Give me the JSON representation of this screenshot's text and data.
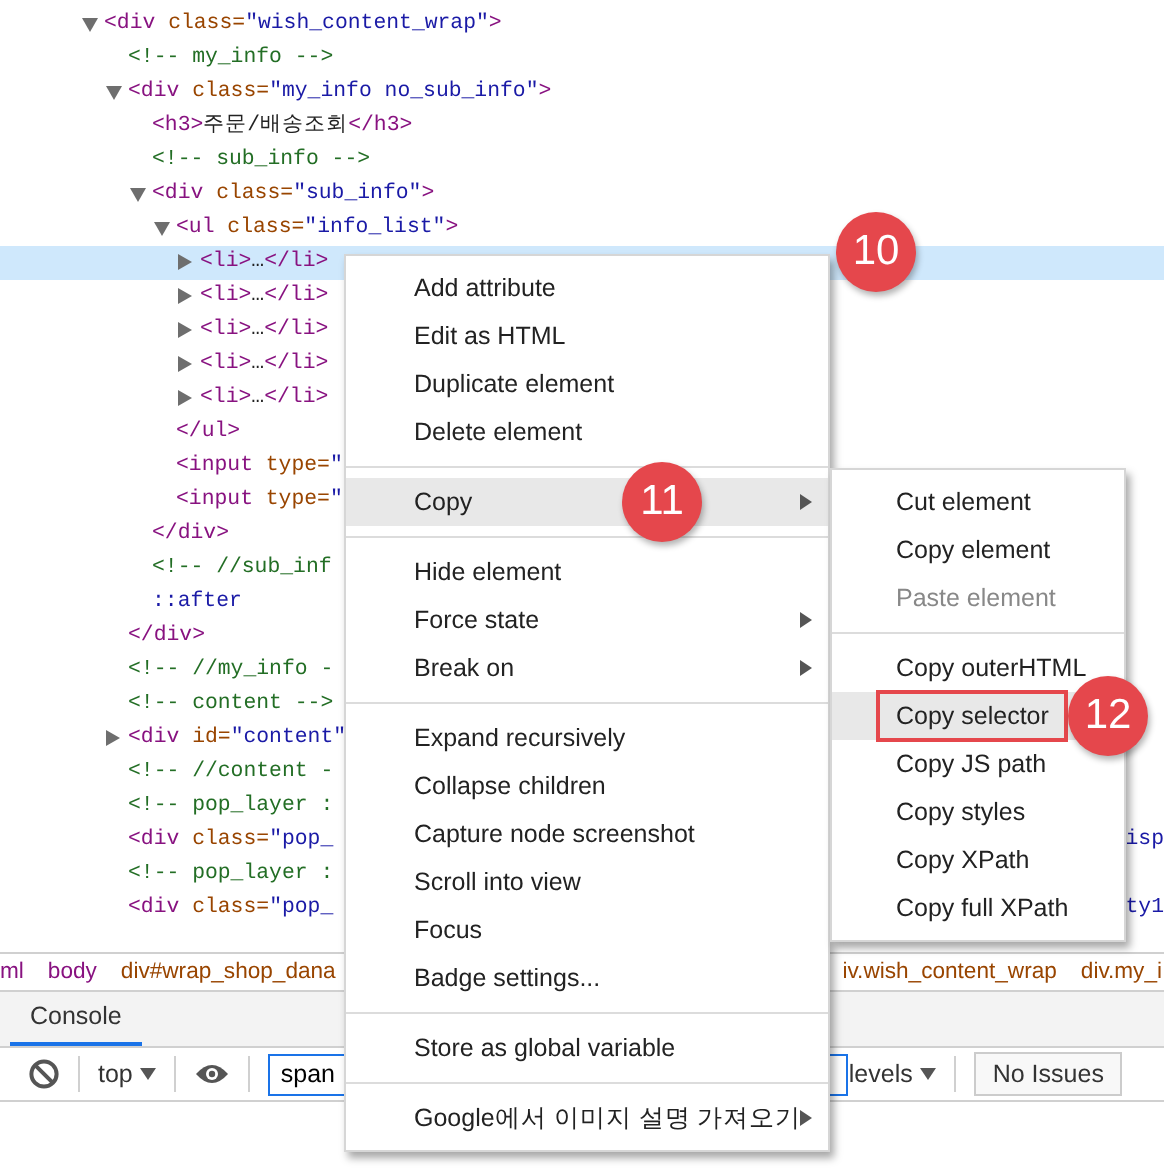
{
  "elements_tree": [
    {
      "expanded": true,
      "tokens": [
        {
          "kind": "tag",
          "text": "<div"
        },
        {
          "kind": "attr",
          "text": " class="
        },
        {
          "kind": "value",
          "text": "\"wish_content_wrap\""
        },
        {
          "kind": "tag",
          "text": ">"
        }
      ],
      "children": [
        {
          "tokens": [
            {
              "kind": "comment",
              "text": "<!-- my_info -->"
            }
          ]
        },
        {
          "expanded": true,
          "tokens": [
            {
              "kind": "tag",
              "text": "<div"
            },
            {
              "kind": "attr",
              "text": " class="
            },
            {
              "kind": "value",
              "text": "\"my_info no_sub_info\""
            },
            {
              "kind": "tag",
              "text": ">"
            }
          ],
          "children": [
            {
              "tokens": [
                {
                  "kind": "tag",
                  "text": "<h3>"
                },
                {
                  "kind": "text",
                  "text": "주문/배송조회"
                },
                {
                  "kind": "tag",
                  "text": "</h3>"
                }
              ]
            },
            {
              "tokens": [
                {
                  "kind": "comment",
                  "text": "<!-- sub_info -->"
                }
              ]
            },
            {
              "expanded": true,
              "tokens": [
                {
                  "kind": "tag",
                  "text": "<div"
                },
                {
                  "kind": "attr",
                  "text": " class="
                },
                {
                  "kind": "value",
                  "text": "\"sub_info\""
                },
                {
                  "kind": "tag",
                  "text": ">"
                }
              ],
              "children": [
                {
                  "expanded": true,
                  "tokens": [
                    {
                      "kind": "tag",
                      "text": "<ul"
                    },
                    {
                      "kind": "attr",
                      "text": " class="
                    },
                    {
                      "kind": "value",
                      "text": "\"info_list\""
                    },
                    {
                      "kind": "tag",
                      "text": ">"
                    }
                  ],
                  "children": [
                    {
                      "expanded": false,
                      "selected": true,
                      "tokens": [
                        {
                          "kind": "tag",
                          "text": "<li>"
                        },
                        {
                          "kind": "text",
                          "text": "…"
                        },
                        {
                          "kind": "tag",
                          "text": "</li>"
                        }
                      ]
                    },
                    {
                      "expanded": false,
                      "selected": false,
                      "tokens": [
                        {
                          "kind": "tag",
                          "text": "<li>"
                        },
                        {
                          "kind": "text",
                          "text": "…"
                        },
                        {
                          "kind": "tag",
                          "text": "</li>"
                        }
                      ]
                    },
                    {
                      "expanded": false,
                      "selected": false,
                      "tokens": [
                        {
                          "kind": "tag",
                          "text": "<li>"
                        },
                        {
                          "kind": "text",
                          "text": "…"
                        },
                        {
                          "kind": "tag",
                          "text": "</li>"
                        }
                      ]
                    },
                    {
                      "expanded": false,
                      "selected": false,
                      "tokens": [
                        {
                          "kind": "tag",
                          "text": "<li>"
                        },
                        {
                          "kind": "text",
                          "text": "…"
                        },
                        {
                          "kind": "tag",
                          "text": "</li>"
                        }
                      ]
                    },
                    {
                      "expanded": false,
                      "selected": false,
                      "tokens": [
                        {
                          "kind": "tag",
                          "text": "<li>"
                        },
                        {
                          "kind": "text",
                          "text": "…"
                        },
                        {
                          "kind": "tag",
                          "text": "</li>"
                        }
                      ]
                    }
                  ],
                  "closing": [
                    {
                      "kind": "tag",
                      "text": "</ul>"
                    }
                  ]
                },
                {
                  "tokens": [
                    {
                      "kind": "tag",
                      "text": "<input"
                    },
                    {
                      "kind": "attr",
                      "text": " type="
                    },
                    {
                      "kind": "value",
                      "text": "\""
                    }
                  ]
                },
                {
                  "tokens": [
                    {
                      "kind": "tag",
                      "text": "<input"
                    },
                    {
                      "kind": "attr",
                      "text": " type="
                    },
                    {
                      "kind": "value",
                      "text": "\""
                    }
                  ]
                }
              ],
              "closing": [
                {
                  "kind": "tag",
                  "text": "</div>"
                }
              ]
            },
            {
              "tokens": [
                {
                  "kind": "comment",
                  "text": "<!-- //sub_inf"
                }
              ]
            },
            {
              "tokens": [
                {
                  "kind": "pseudo",
                  "text": "::after"
                }
              ]
            }
          ],
          "closing": [
            {
              "kind": "tag",
              "text": "</div>"
            }
          ]
        },
        {
          "tokens": [
            {
              "kind": "comment",
              "text": "<!-- //my_info -"
            }
          ]
        },
        {
          "tokens": [
            {
              "kind": "comment",
              "text": "<!-- content -->"
            }
          ]
        },
        {
          "expanded": false,
          "tokens": [
            {
              "kind": "tag",
              "text": "<div"
            },
            {
              "kind": "attr",
              "text": " id="
            },
            {
              "kind": "value",
              "text": "\"content\""
            }
          ]
        },
        {
          "tokens": [
            {
              "kind": "comment",
              "text": "<!-- //content -"
            }
          ]
        },
        {
          "tokens": [
            {
              "kind": "comment",
              "text": "<!-- pop_layer :"
            }
          ]
        },
        {
          "tokens": [
            {
              "kind": "tag",
              "text": "<div"
            },
            {
              "kind": "attr",
              "text": " class="
            },
            {
              "kind": "value",
              "text": "\"pop_"
            }
          ],
          "tail": "isp"
        },
        {
          "tokens": [
            {
              "kind": "comment",
              "text": "<!-- pop_layer :"
            }
          ]
        },
        {
          "tokens": [
            {
              "kind": "tag",
              "text": "<div"
            },
            {
              "kind": "attr",
              "text": " class="
            },
            {
              "kind": "value",
              "text": "\"pop_"
            }
          ],
          "tail": "ty1"
        }
      ]
    }
  ],
  "breadcrumbs": [
    "ml",
    "body",
    "div#wrap_shop_dana",
    "iv.wish_content_wrap",
    "div.my_i"
  ],
  "drawer_tabs": [
    {
      "label": "Console",
      "selected": true
    }
  ],
  "console_toolbar": {
    "context": "top",
    "filter_value": "span",
    "levels": "levels",
    "issues": "No Issues"
  },
  "context_menu": {
    "callout": "10",
    "items": [
      {
        "kind": "item",
        "label": "Add attribute"
      },
      {
        "kind": "item",
        "label": "Edit as HTML"
      },
      {
        "kind": "item",
        "label": "Duplicate element"
      },
      {
        "kind": "item",
        "label": "Delete element"
      },
      {
        "kind": "separator"
      },
      {
        "kind": "item",
        "label": "Copy",
        "has_submenu": true,
        "highlighted": true,
        "callout": "11"
      },
      {
        "kind": "separator"
      },
      {
        "kind": "item",
        "label": "Hide element"
      },
      {
        "kind": "item",
        "label": "Force state",
        "has_submenu": true
      },
      {
        "kind": "item",
        "label": "Break on",
        "has_submenu": true
      },
      {
        "kind": "separator"
      },
      {
        "kind": "item",
        "label": "Expand recursively"
      },
      {
        "kind": "item",
        "label": "Collapse children"
      },
      {
        "kind": "item",
        "label": "Capture node screenshot"
      },
      {
        "kind": "item",
        "label": "Scroll into view"
      },
      {
        "kind": "item",
        "label": "Focus"
      },
      {
        "kind": "item",
        "label": "Badge settings..."
      },
      {
        "kind": "separator"
      },
      {
        "kind": "item",
        "label": "Store as global variable"
      },
      {
        "kind": "separator"
      },
      {
        "kind": "item",
        "label": "Google에서 이미지 설명 가져오기",
        "has_submenu": true
      }
    ]
  },
  "copy_submenu": {
    "items": [
      {
        "kind": "item",
        "label": "Cut element"
      },
      {
        "kind": "item",
        "label": "Copy element"
      },
      {
        "kind": "item",
        "label": "Paste element",
        "disabled": true
      },
      {
        "kind": "separator"
      },
      {
        "kind": "item",
        "label": "Copy outerHTML"
      },
      {
        "kind": "item",
        "label": "Copy selector",
        "highlighted": true,
        "outlined": true,
        "callout": "12"
      },
      {
        "kind": "item",
        "label": "Copy JS path"
      },
      {
        "kind": "item",
        "label": "Copy styles"
      },
      {
        "kind": "item",
        "label": "Copy XPath"
      },
      {
        "kind": "item",
        "label": "Copy full XPath"
      }
    ]
  }
}
